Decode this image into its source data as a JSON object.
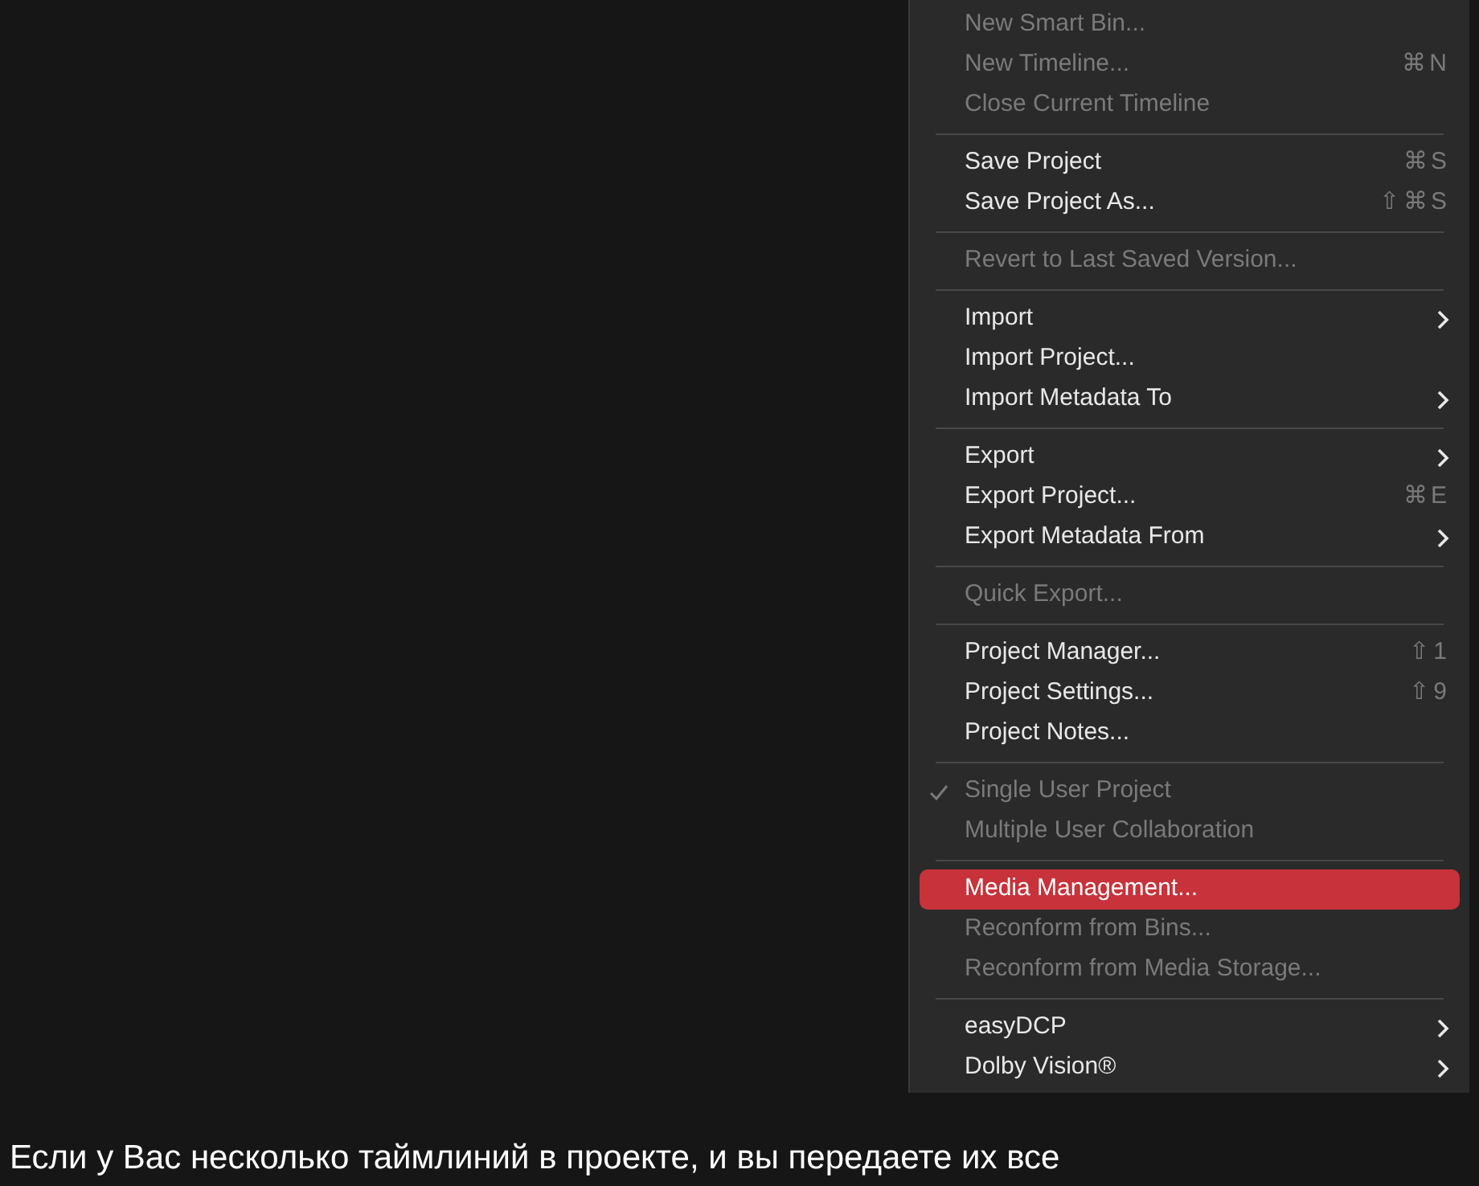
{
  "menu": {
    "sections": [
      [
        {
          "label": "New Smart Bin...",
          "disabled": true,
          "selected": false
        },
        {
          "label": "New Timeline...",
          "shortcut": "⌘N",
          "disabled": true,
          "selected": false
        },
        {
          "label": "Close Current Timeline",
          "disabled": true,
          "selected": false
        }
      ],
      [
        {
          "label": "Save Project",
          "shortcut": "⌘S",
          "disabled": false,
          "selected": false
        },
        {
          "label": "Save Project As...",
          "shortcut": "⇧⌘S",
          "disabled": false,
          "selected": false
        }
      ],
      [
        {
          "label": "Revert to Last Saved Version...",
          "disabled": true,
          "selected": false
        }
      ],
      [
        {
          "label": "Import",
          "submenu": true,
          "disabled": false,
          "selected": false
        },
        {
          "label": "Import Project...",
          "disabled": false,
          "selected": false
        },
        {
          "label": "Import Metadata To",
          "submenu": true,
          "disabled": false,
          "selected": false
        }
      ],
      [
        {
          "label": "Export",
          "submenu": true,
          "disabled": false,
          "selected": false
        },
        {
          "label": "Export Project...",
          "shortcut": "⌘E",
          "disabled": false,
          "selected": false
        },
        {
          "label": "Export Metadata From",
          "submenu": true,
          "disabled": false,
          "selected": false
        }
      ],
      [
        {
          "label": "Quick Export...",
          "disabled": true,
          "selected": false
        }
      ],
      [
        {
          "label": "Project Manager...",
          "shortcut": "⇧1",
          "disabled": false,
          "selected": false
        },
        {
          "label": "Project Settings...",
          "shortcut": "⇧9",
          "disabled": false,
          "selected": false
        },
        {
          "label": "Project Notes...",
          "disabled": false,
          "selected": false
        }
      ],
      [
        {
          "label": "Single User Project",
          "checked": true,
          "disabled": true,
          "selected": false
        },
        {
          "label": "Multiple User Collaboration",
          "checked": false,
          "disabled": true,
          "selected": false
        }
      ],
      [
        {
          "label": "Media Management...",
          "disabled": false,
          "selected": true
        },
        {
          "label": "Reconform from Bins...",
          "disabled": true,
          "selected": false
        },
        {
          "label": "Reconform from Media Storage...",
          "disabled": true,
          "selected": false
        }
      ],
      [
        {
          "label": "easyDCP",
          "submenu": true,
          "disabled": false,
          "selected": false
        },
        {
          "label": "Dolby Vision®",
          "submenu": true,
          "disabled": false,
          "selected": false
        }
      ]
    ]
  },
  "caption": "Если у Вас несколько таймлиний в проекте, и вы передаете их все"
}
